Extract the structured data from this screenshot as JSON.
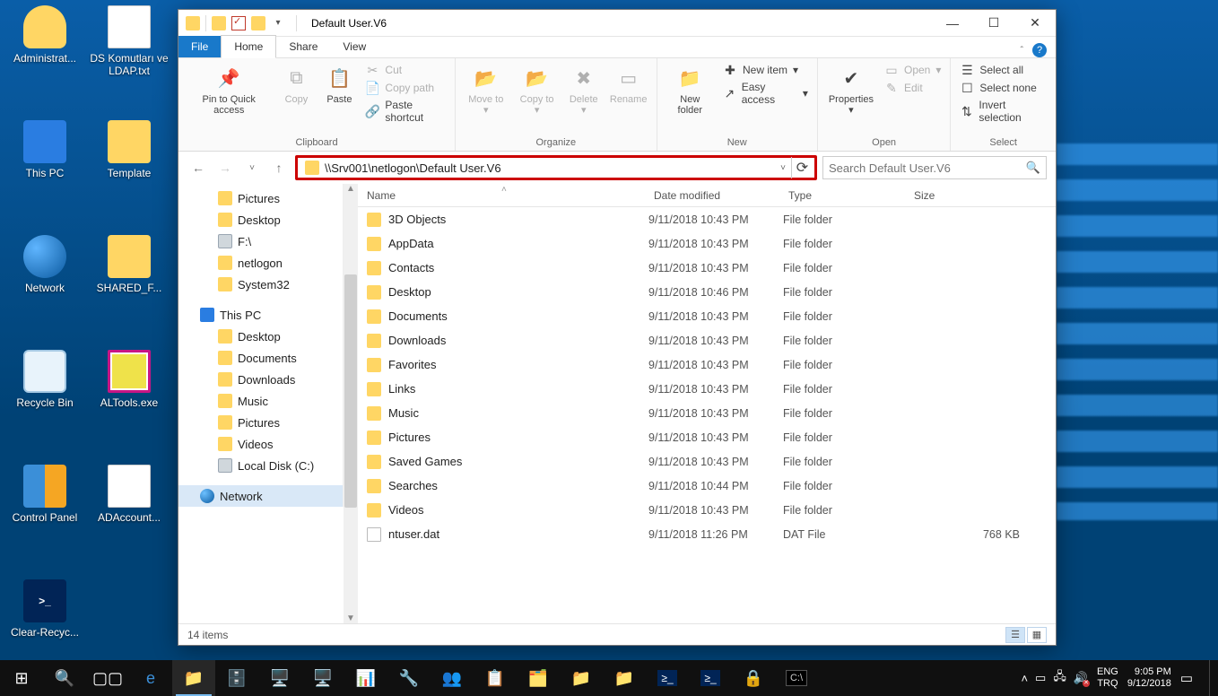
{
  "desktop": {
    "icons": [
      {
        "label": "Administrat...",
        "kind": "user"
      },
      {
        "label": "DS Komutları ve LDAP.txt",
        "kind": "txt"
      },
      {
        "label": "This PC",
        "kind": "pc"
      },
      {
        "label": "Template",
        "kind": "folder"
      },
      {
        "label": "Network",
        "kind": "net"
      },
      {
        "label": "SHARED_F...",
        "kind": "folder"
      },
      {
        "label": "Recycle Bin",
        "kind": "bin"
      },
      {
        "label": "ALTools.exe",
        "kind": "exe"
      },
      {
        "label": "Control Panel",
        "kind": "cp"
      },
      {
        "label": "ADAccount...",
        "kind": "txt"
      },
      {
        "label": "Clear-Recyc...",
        "kind": "ps"
      }
    ]
  },
  "window": {
    "title": "Default User.V6",
    "tabs": {
      "file": "File",
      "home": "Home",
      "share": "Share",
      "view": "View"
    },
    "ribbon": {
      "clipboard": {
        "name": "Clipboard",
        "pin": "Pin to Quick access",
        "copy": "Copy",
        "paste": "Paste",
        "cut": "Cut",
        "copypath": "Copy path",
        "pasteshortcut": "Paste shortcut"
      },
      "organize": {
        "name": "Organize",
        "moveto": "Move to",
        "copyto": "Copy to",
        "delete": "Delete",
        "rename": "Rename"
      },
      "new": {
        "name": "New",
        "newfolder": "New folder",
        "newitem": "New item",
        "easyaccess": "Easy access"
      },
      "open": {
        "name": "Open",
        "properties": "Properties",
        "open": "Open",
        "edit": "Edit"
      },
      "select": {
        "name": "Select",
        "selectall": "Select all",
        "selectnone": "Select none",
        "invert": "Invert selection"
      }
    },
    "address": "\\\\Srv001\\netlogon\\Default User.V6",
    "search_placeholder": "Search Default User.V6",
    "nav": [
      {
        "label": "Pictures",
        "lvl": 1,
        "kind": "folder"
      },
      {
        "label": "Desktop",
        "lvl": 1,
        "kind": "folder"
      },
      {
        "label": "F:\\",
        "lvl": 1,
        "kind": "drive"
      },
      {
        "label": "netlogon",
        "lvl": 1,
        "kind": "folder"
      },
      {
        "label": "System32",
        "lvl": 1,
        "kind": "folder"
      },
      {
        "label": "This PC",
        "lvl": 0,
        "kind": "pc"
      },
      {
        "label": "Desktop",
        "lvl": 1,
        "kind": "folder"
      },
      {
        "label": "Documents",
        "lvl": 1,
        "kind": "folder"
      },
      {
        "label": "Downloads",
        "lvl": 1,
        "kind": "folder"
      },
      {
        "label": "Music",
        "lvl": 1,
        "kind": "folder"
      },
      {
        "label": "Pictures",
        "lvl": 1,
        "kind": "folder"
      },
      {
        "label": "Videos",
        "lvl": 1,
        "kind": "folder"
      },
      {
        "label": "Local Disk (C:)",
        "lvl": 1,
        "kind": "drive"
      },
      {
        "label": "Network",
        "lvl": 0,
        "kind": "net",
        "sel": true
      }
    ],
    "columns": {
      "name": "Name",
      "date": "Date modified",
      "type": "Type",
      "size": "Size"
    },
    "rows": [
      {
        "name": "3D Objects",
        "date": "9/11/2018 10:43 PM",
        "type": "File folder",
        "size": "",
        "kind": "folder"
      },
      {
        "name": "AppData",
        "date": "9/11/2018 10:43 PM",
        "type": "File folder",
        "size": "",
        "kind": "folder"
      },
      {
        "name": "Contacts",
        "date": "9/11/2018 10:43 PM",
        "type": "File folder",
        "size": "",
        "kind": "folder"
      },
      {
        "name": "Desktop",
        "date": "9/11/2018 10:46 PM",
        "type": "File folder",
        "size": "",
        "kind": "folder"
      },
      {
        "name": "Documents",
        "date": "9/11/2018 10:43 PM",
        "type": "File folder",
        "size": "",
        "kind": "folder"
      },
      {
        "name": "Downloads",
        "date": "9/11/2018 10:43 PM",
        "type": "File folder",
        "size": "",
        "kind": "folder"
      },
      {
        "name": "Favorites",
        "date": "9/11/2018 10:43 PM",
        "type": "File folder",
        "size": "",
        "kind": "folder"
      },
      {
        "name": "Links",
        "date": "9/11/2018 10:43 PM",
        "type": "File folder",
        "size": "",
        "kind": "folder"
      },
      {
        "name": "Music",
        "date": "9/11/2018 10:43 PM",
        "type": "File folder",
        "size": "",
        "kind": "folder"
      },
      {
        "name": "Pictures",
        "date": "9/11/2018 10:43 PM",
        "type": "File folder",
        "size": "",
        "kind": "folder"
      },
      {
        "name": "Saved Games",
        "date": "9/11/2018 10:43 PM",
        "type": "File folder",
        "size": "",
        "kind": "folder"
      },
      {
        "name": "Searches",
        "date": "9/11/2018 10:44 PM",
        "type": "File folder",
        "size": "",
        "kind": "folder"
      },
      {
        "name": "Videos",
        "date": "9/11/2018 10:43 PM",
        "type": "File folder",
        "size": "",
        "kind": "folder"
      },
      {
        "name": "ntuser.dat",
        "date": "9/11/2018 11:26 PM",
        "type": "DAT File",
        "size": "768 KB",
        "kind": "file"
      }
    ],
    "status": "14 items"
  },
  "taskbar": {
    "lang1": "ENG",
    "lang2": "TRQ",
    "time": "9:05 PM",
    "date": "9/12/2018"
  }
}
